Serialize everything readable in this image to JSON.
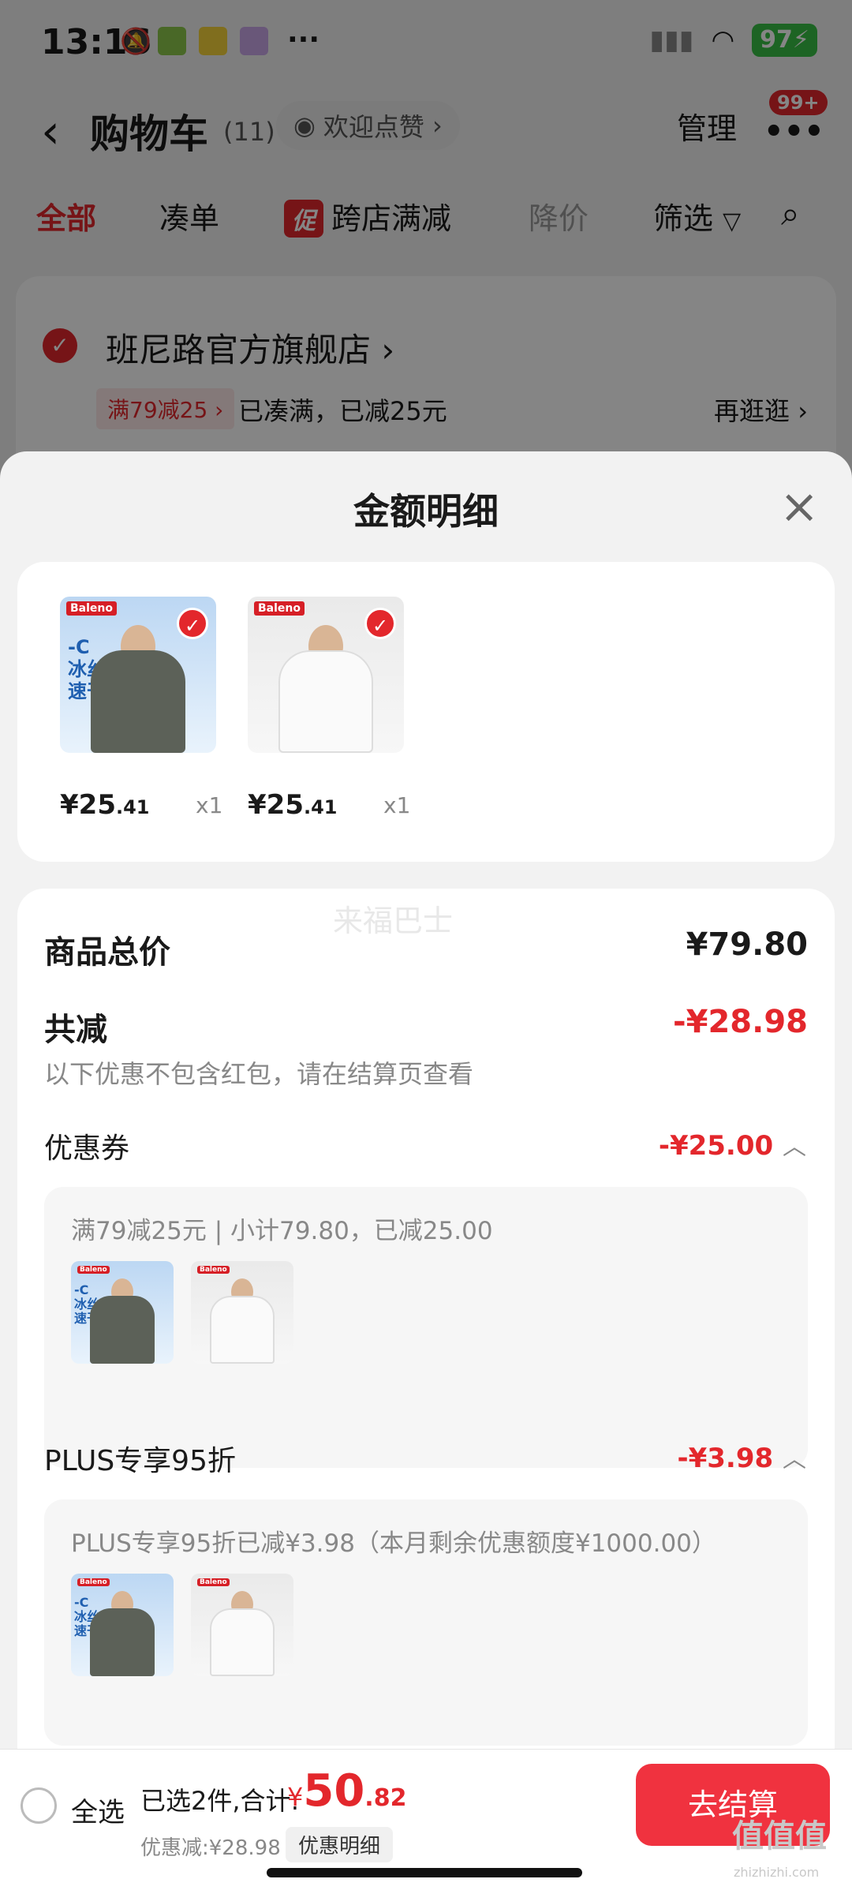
{
  "status_bar": {
    "time": "13:16",
    "ellipsis": "···",
    "battery": "97"
  },
  "header": {
    "back": "‹",
    "title": "购物车",
    "count": "(11)",
    "like_text": "欢迎点赞",
    "manage": "管理",
    "more_badge": "99+"
  },
  "tabs": [
    "全部",
    "凑单",
    "跨店满减",
    "降价",
    "筛选"
  ],
  "promo_icon_text": "促",
  "store": {
    "name": "班尼路官方旗舰店",
    "coupon_tag": "满79减25",
    "coupon_status": "已凑满，已减25元",
    "browse": "再逛逛"
  },
  "sheet": {
    "title": "金额明细",
    "close": "×",
    "watermark": "来福巴士",
    "items": [
      {
        "price_int": "¥25",
        "price_dec": ".41",
        "qty": "x1",
        "shirt": "gray"
      },
      {
        "price_int": "¥25",
        "price_dec": ".41",
        "qty": "x1",
        "shirt": "white"
      }
    ],
    "thumb_brand": "Baleno",
    "thumb_cool_text": "-C\n冰丝\n速干",
    "total_label": "商品总价",
    "total_value": "¥79.80",
    "discount_label": "共减",
    "discount_value": "-¥28.98",
    "discount_hint": "以下优惠不包含红包，请在结算页查看",
    "coupon": {
      "label": "优惠券",
      "value": "-¥25.00",
      "detail": "满79减25元 | 小计79.80，已减25.00"
    },
    "plus": {
      "label": "PLUS专享95折",
      "value": "-¥3.98",
      "detail": "PLUS专享95折已减¥3.98（本月剩余优惠额度¥1000.00）"
    }
  },
  "bottom_bar": {
    "select_all": "全选",
    "selected_info": "已选2件,合计:",
    "total_currency": "¥",
    "total_int": "50",
    "total_dec": ".82",
    "saved": "优惠减:¥28.98",
    "detail_button": "优惠明细",
    "checkout": "去结算",
    "site_watermark": "值值值",
    "site_url": "zhizhizhi.com"
  },
  "colors": {
    "accent_red": "#e3272c",
    "checkout_red": "#f0323f",
    "battery_green": "#38c046"
  }
}
